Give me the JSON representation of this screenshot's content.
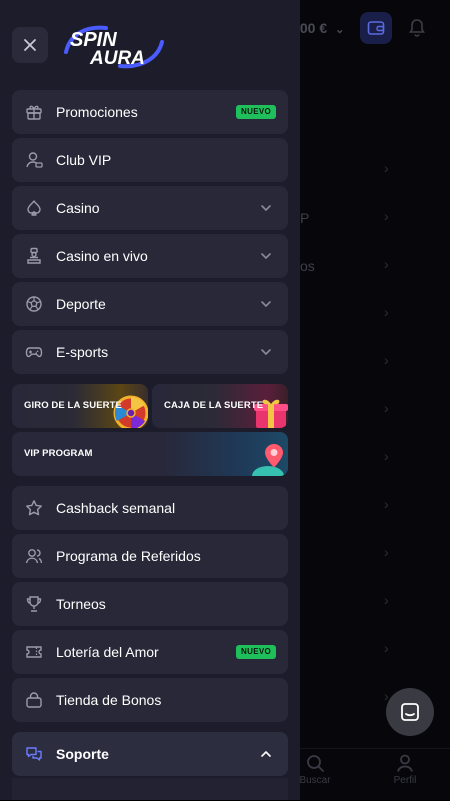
{
  "header": {
    "balance": ".00 €",
    "logo_text_top": "SPIN",
    "logo_text_bottom": "AURA"
  },
  "menu": {
    "promociones": {
      "label": "Promociones",
      "badge": "NUEVO"
    },
    "club_vip": {
      "label": "Club VIP"
    },
    "casino": {
      "label": "Casino"
    },
    "casino_en_vivo": {
      "label": "Casino en vivo"
    },
    "deporte": {
      "label": "Deporte"
    },
    "esports": {
      "label": "E-sports"
    },
    "cashback": {
      "label": "Cashback semanal"
    },
    "referidos": {
      "label": "Programa de Referidos"
    },
    "torneos": {
      "label": "Torneos"
    },
    "loteria": {
      "label": "Lotería del Amor",
      "badge": "NUEVO"
    },
    "tienda": {
      "label": "Tienda de Bonos"
    },
    "soporte": {
      "label": "Soporte"
    }
  },
  "promos": {
    "giro": "GIRO DE LA SUERTE",
    "caja": "CAJA DE LA SUERTE",
    "vip": "VIP PROGRAM"
  },
  "background": {
    "row_fragments": [
      "P",
      "os"
    ],
    "bottom_nav": {
      "buscar": "Buscar",
      "perfil": "Perfil"
    }
  },
  "colors": {
    "drawer_bg": "#1c1c2b",
    "item_bg": "#282838",
    "badge_green": "#1fbf5b",
    "accent_blue": "#4b5cff"
  }
}
